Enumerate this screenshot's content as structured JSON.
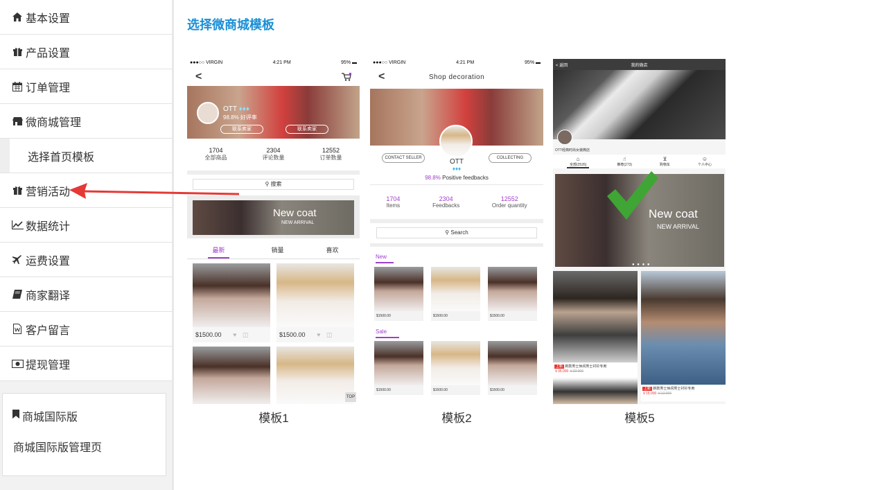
{
  "sidebar": {
    "items": [
      {
        "label": "基本设置",
        "icon": "home-icon"
      },
      {
        "label": "产品设置",
        "icon": "gift-icon"
      },
      {
        "label": "订单管理",
        "icon": "calendar-icon"
      },
      {
        "label": "微商城管理",
        "icon": "shop-icon"
      },
      {
        "label": "选择首页模板",
        "icon": ""
      },
      {
        "label": "营销活动",
        "icon": "gift-icon"
      },
      {
        "label": "数据统计",
        "icon": "line-chart-icon"
      },
      {
        "label": "运费设置",
        "icon": "plane-icon"
      },
      {
        "label": "商家翻译",
        "icon": "book-icon"
      },
      {
        "label": "客户留言",
        "icon": "document-icon"
      },
      {
        "label": "提现管理",
        "icon": "money-icon"
      }
    ],
    "intl": {
      "title": "商城国际版",
      "link": "商城国际版管理页"
    }
  },
  "page": {
    "title": "选择微商城模板"
  },
  "templates": [
    {
      "label": "模板1",
      "status": {
        "carrier": "●●●○○ VIRGIN",
        "time": "4:21 PM",
        "battery": "95%"
      },
      "shop_name": "OTT",
      "rating": "98.8%  好评率",
      "btn_contact": "联系卖家",
      "btn_collect": "联系卖家",
      "stats": [
        {
          "n": "1704",
          "l": "全部商品"
        },
        {
          "n": "2304",
          "l": "评论数量"
        },
        {
          "n": "12552",
          "l": "订单数量"
        }
      ],
      "search": "搜索",
      "banner_title": "New coat",
      "banner_sub": "NEW ARRIVAL",
      "tabs": [
        "最新",
        "销量",
        "喜欢"
      ],
      "prices": [
        "$1500.00",
        "$1500.00"
      ],
      "top_label": "TOP"
    },
    {
      "label": "模板2",
      "status": {
        "carrier": "●●●○○ VIRGIN",
        "time": "4:21 PM",
        "battery": "95%"
      },
      "header": "Shop decoration",
      "btn_contact": "CONTACT SELLER",
      "btn_collect": "COLLECTING",
      "shop_name": "OTT",
      "rating_pct": "98.8%",
      "rating_text": "Positive feedbacks",
      "stats": [
        {
          "n": "1704",
          "l": "Items"
        },
        {
          "n": "2304",
          "l": "Feedbacks"
        },
        {
          "n": "12552",
          "l": "Order quantity"
        }
      ],
      "search": "Search",
      "section_new": "New",
      "section_sale": "Sale",
      "price": "$1500.00"
    },
    {
      "label": "模板5",
      "header_back": "< 返回",
      "header_title": "我的微店",
      "shop_caption": "OTT经典时尚女装微店",
      "tabs": [
        "全部(2526)",
        "推荐(273)",
        "购物车",
        "个人中心"
      ],
      "banner_title": "New coat",
      "banner_sub": "NEW ARRIVAL",
      "item1_tag": "上新",
      "item1_name": "新款男士休闲男士衬衫专用",
      "item1_price": "￥35.000",
      "item1_old": "￥32.000",
      "item2_tag": "上新",
      "item2_name": "新款男士休闲男士衬衫专用",
      "item2_price": "￥15.000",
      "item2_old": "￥12.000"
    }
  ],
  "colors": {
    "accent": "#1a8fd6",
    "arrow": "#e53935",
    "check": "#3fa535",
    "purple": "#a03ec9"
  }
}
